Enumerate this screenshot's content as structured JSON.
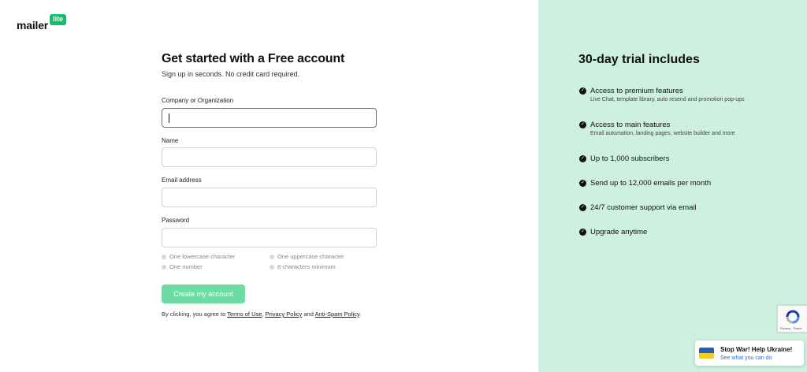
{
  "brand": {
    "name": "mailer",
    "badge": "lite"
  },
  "form": {
    "title": "Get started with a Free account",
    "subtitle": "Sign up in seconds. No credit card required.",
    "fields": {
      "company": {
        "label": "Company or Organization",
        "value": "",
        "placeholder": ""
      },
      "name": {
        "label": "Name",
        "value": "",
        "placeholder": ""
      },
      "email": {
        "label": "Email address",
        "value": "",
        "placeholder": ""
      },
      "password": {
        "label": "Password",
        "value": "",
        "placeholder": ""
      }
    },
    "password_requirements": [
      "One lowercase character",
      "One uppercase character",
      "One number",
      "8 characters minimum"
    ],
    "submit_label": "Create my account",
    "terms": {
      "prefix": "By clicking, you agree to ",
      "terms_link": "Terms of Use",
      "sep1": ", ",
      "privacy_link": "Privacy Policy",
      "sep2": " and ",
      "antispam_link": "Anti-Spam Policy",
      "suffix": "."
    }
  },
  "trial": {
    "title": "30-day trial includes",
    "features": [
      {
        "title": "Access to premium features",
        "desc": "Live Chat, template library, auto resend and promotion pop-ups",
        "icon": "check-circle-icon"
      },
      {
        "title": "Access to main features",
        "desc": "Email automation, landing pages, website builder and more",
        "icon": "check-circle-icon"
      },
      {
        "title": "Up to 1,000 subscribers",
        "desc": "",
        "icon": "check-circle-icon"
      },
      {
        "title": "Send up to 12,000 emails per month",
        "desc": "",
        "icon": "check-circle-icon"
      },
      {
        "title": "24/7 customer support via email",
        "desc": "",
        "icon": "check-circle-icon"
      },
      {
        "title": "Upgrade anytime",
        "desc": "",
        "icon": "check-circle-icon"
      }
    ]
  },
  "recaptcha": {
    "text": "Privacy - Terms",
    "icon": "recaptcha-icon"
  },
  "ukraine_banner": {
    "title": "Stop War! Help Ukraine!",
    "link": "See what you can do",
    "icon": "ukraine-flag-icon"
  },
  "colors": {
    "brand_green": "#09c269",
    "panel_bg": "#cdf0df",
    "button_bg": "#6ddca4",
    "link_blue": "#2a6ee0"
  }
}
